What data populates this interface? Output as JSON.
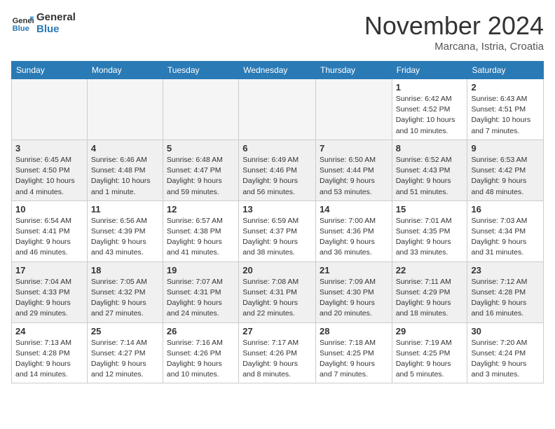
{
  "logo": {
    "line1": "General",
    "line2": "Blue"
  },
  "title": "November 2024",
  "subtitle": "Marcana, Istria, Croatia",
  "days_of_week": [
    "Sunday",
    "Monday",
    "Tuesday",
    "Wednesday",
    "Thursday",
    "Friday",
    "Saturday"
  ],
  "weeks": [
    {
      "shaded": false,
      "days": [
        {
          "num": "",
          "info": "",
          "empty": true
        },
        {
          "num": "",
          "info": "",
          "empty": true
        },
        {
          "num": "",
          "info": "",
          "empty": true
        },
        {
          "num": "",
          "info": "",
          "empty": true
        },
        {
          "num": "",
          "info": "",
          "empty": true
        },
        {
          "num": "1",
          "info": "Sunrise: 6:42 AM\nSunset: 4:52 PM\nDaylight: 10 hours and 10 minutes.",
          "empty": false
        },
        {
          "num": "2",
          "info": "Sunrise: 6:43 AM\nSunset: 4:51 PM\nDaylight: 10 hours and 7 minutes.",
          "empty": false
        }
      ]
    },
    {
      "shaded": true,
      "days": [
        {
          "num": "3",
          "info": "Sunrise: 6:45 AM\nSunset: 4:50 PM\nDaylight: 10 hours and 4 minutes.",
          "empty": false
        },
        {
          "num": "4",
          "info": "Sunrise: 6:46 AM\nSunset: 4:48 PM\nDaylight: 10 hours and 1 minute.",
          "empty": false
        },
        {
          "num": "5",
          "info": "Sunrise: 6:48 AM\nSunset: 4:47 PM\nDaylight: 9 hours and 59 minutes.",
          "empty": false
        },
        {
          "num": "6",
          "info": "Sunrise: 6:49 AM\nSunset: 4:46 PM\nDaylight: 9 hours and 56 minutes.",
          "empty": false
        },
        {
          "num": "7",
          "info": "Sunrise: 6:50 AM\nSunset: 4:44 PM\nDaylight: 9 hours and 53 minutes.",
          "empty": false
        },
        {
          "num": "8",
          "info": "Sunrise: 6:52 AM\nSunset: 4:43 PM\nDaylight: 9 hours and 51 minutes.",
          "empty": false
        },
        {
          "num": "9",
          "info": "Sunrise: 6:53 AM\nSunset: 4:42 PM\nDaylight: 9 hours and 48 minutes.",
          "empty": false
        }
      ]
    },
    {
      "shaded": false,
      "days": [
        {
          "num": "10",
          "info": "Sunrise: 6:54 AM\nSunset: 4:41 PM\nDaylight: 9 hours and 46 minutes.",
          "empty": false
        },
        {
          "num": "11",
          "info": "Sunrise: 6:56 AM\nSunset: 4:39 PM\nDaylight: 9 hours and 43 minutes.",
          "empty": false
        },
        {
          "num": "12",
          "info": "Sunrise: 6:57 AM\nSunset: 4:38 PM\nDaylight: 9 hours and 41 minutes.",
          "empty": false
        },
        {
          "num": "13",
          "info": "Sunrise: 6:59 AM\nSunset: 4:37 PM\nDaylight: 9 hours and 38 minutes.",
          "empty": false
        },
        {
          "num": "14",
          "info": "Sunrise: 7:00 AM\nSunset: 4:36 PM\nDaylight: 9 hours and 36 minutes.",
          "empty": false
        },
        {
          "num": "15",
          "info": "Sunrise: 7:01 AM\nSunset: 4:35 PM\nDaylight: 9 hours and 33 minutes.",
          "empty": false
        },
        {
          "num": "16",
          "info": "Sunrise: 7:03 AM\nSunset: 4:34 PM\nDaylight: 9 hours and 31 minutes.",
          "empty": false
        }
      ]
    },
    {
      "shaded": true,
      "days": [
        {
          "num": "17",
          "info": "Sunrise: 7:04 AM\nSunset: 4:33 PM\nDaylight: 9 hours and 29 minutes.",
          "empty": false
        },
        {
          "num": "18",
          "info": "Sunrise: 7:05 AM\nSunset: 4:32 PM\nDaylight: 9 hours and 27 minutes.",
          "empty": false
        },
        {
          "num": "19",
          "info": "Sunrise: 7:07 AM\nSunset: 4:31 PM\nDaylight: 9 hours and 24 minutes.",
          "empty": false
        },
        {
          "num": "20",
          "info": "Sunrise: 7:08 AM\nSunset: 4:31 PM\nDaylight: 9 hours and 22 minutes.",
          "empty": false
        },
        {
          "num": "21",
          "info": "Sunrise: 7:09 AM\nSunset: 4:30 PM\nDaylight: 9 hours and 20 minutes.",
          "empty": false
        },
        {
          "num": "22",
          "info": "Sunrise: 7:11 AM\nSunset: 4:29 PM\nDaylight: 9 hours and 18 minutes.",
          "empty": false
        },
        {
          "num": "23",
          "info": "Sunrise: 7:12 AM\nSunset: 4:28 PM\nDaylight: 9 hours and 16 minutes.",
          "empty": false
        }
      ]
    },
    {
      "shaded": false,
      "days": [
        {
          "num": "24",
          "info": "Sunrise: 7:13 AM\nSunset: 4:28 PM\nDaylight: 9 hours and 14 minutes.",
          "empty": false
        },
        {
          "num": "25",
          "info": "Sunrise: 7:14 AM\nSunset: 4:27 PM\nDaylight: 9 hours and 12 minutes.",
          "empty": false
        },
        {
          "num": "26",
          "info": "Sunrise: 7:16 AM\nSunset: 4:26 PM\nDaylight: 9 hours and 10 minutes.",
          "empty": false
        },
        {
          "num": "27",
          "info": "Sunrise: 7:17 AM\nSunset: 4:26 PM\nDaylight: 9 hours and 8 minutes.",
          "empty": false
        },
        {
          "num": "28",
          "info": "Sunrise: 7:18 AM\nSunset: 4:25 PM\nDaylight: 9 hours and 7 minutes.",
          "empty": false
        },
        {
          "num": "29",
          "info": "Sunrise: 7:19 AM\nSunset: 4:25 PM\nDaylight: 9 hours and 5 minutes.",
          "empty": false
        },
        {
          "num": "30",
          "info": "Sunrise: 7:20 AM\nSunset: 4:24 PM\nDaylight: 9 hours and 3 minutes.",
          "empty": false
        }
      ]
    }
  ]
}
